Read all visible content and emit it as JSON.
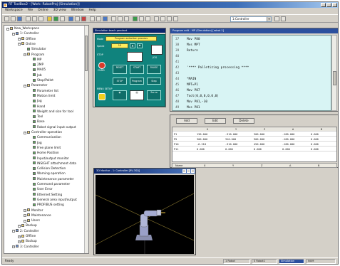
{
  "window": {
    "title": "RT ToolBox2 - [Work: RobotProj (Simulation)]"
  },
  "menu": [
    "Workspace",
    "File",
    "Online",
    "3D view",
    "Window",
    "Help"
  ],
  "toolbar": {
    "robot_combo": "1:Controller"
  },
  "tree": {
    "items": [
      {
        "label": "New_Workspace",
        "depth": 0,
        "icon": "yellow"
      },
      {
        "label": "1: Controller",
        "depth": 1,
        "icon": "blue"
      },
      {
        "label": "Offline",
        "depth": 2,
        "icon": "yellow"
      },
      {
        "label": "Online",
        "depth": 2,
        "icon": "yellow"
      },
      {
        "label": "Simulator",
        "depth": 3,
        "icon": "green"
      },
      {
        "label": "Program",
        "depth": 3,
        "icon": "yellow"
      },
      {
        "label": "MP",
        "depth": 4,
        "icon": "green"
      },
      {
        "label": "2MP",
        "depth": 4,
        "icon": "green"
      },
      {
        "label": "MA05",
        "depth": 4,
        "icon": "green"
      },
      {
        "label": "Job",
        "depth": 4,
        "icon": "green"
      },
      {
        "label": "Stop/Pallet",
        "depth": 4,
        "icon": "green"
      },
      {
        "label": "Parameter",
        "depth": 3,
        "icon": "yellow"
      },
      {
        "label": "Parameter list",
        "depth": 4,
        "icon": "green"
      },
      {
        "label": "Motion limit",
        "depth": 4,
        "icon": "green"
      },
      {
        "label": "Jog",
        "depth": 4,
        "icon": "green"
      },
      {
        "label": "Hand",
        "depth": 4,
        "icon": "green"
      },
      {
        "label": "Weight and size for tool",
        "depth": 4,
        "icon": "green"
      },
      {
        "label": "Tool",
        "depth": 4,
        "icon": "green"
      },
      {
        "label": "Base",
        "depth": 4,
        "icon": "green"
      },
      {
        "label": "Robot signal input output",
        "depth": 4,
        "icon": "green"
      },
      {
        "label": "Controller operation",
        "depth": 3,
        "icon": "yellow"
      },
      {
        "label": "Communication",
        "depth": 4,
        "icon": "green"
      },
      {
        "label": "Jog",
        "depth": 4,
        "icon": "green"
      },
      {
        "label": "Free plane limit",
        "depth": 4,
        "icon": "green"
      },
      {
        "label": "Home Position",
        "depth": 4,
        "icon": "green"
      },
      {
        "label": "Input/output monitor",
        "depth": 4,
        "icon": "green"
      },
      {
        "label": "INSIGHT attachment data",
        "depth": 4,
        "icon": "green"
      },
      {
        "label": "Collision Detection",
        "depth": 4,
        "icon": "green"
      },
      {
        "label": "Warning operation",
        "depth": 4,
        "icon": "green"
      },
      {
        "label": "Maintenance parameter",
        "depth": 4,
        "icon": "green"
      },
      {
        "label": "Command parameter",
        "depth": 4,
        "icon": "green"
      },
      {
        "label": "User Error",
        "depth": 4,
        "icon": "green"
      },
      {
        "label": "Ethernet Setting",
        "depth": 4,
        "icon": "green"
      },
      {
        "label": "General area input/output",
        "depth": 4,
        "icon": "green"
      },
      {
        "label": "PROFIBUS setting",
        "depth": 4,
        "icon": "green"
      },
      {
        "label": "Monitor",
        "depth": 3,
        "icon": "yellow"
      },
      {
        "label": "Maintenance",
        "depth": 3,
        "icon": "yellow"
      },
      {
        "label": "Users",
        "depth": 3,
        "icon": "yellow"
      },
      {
        "label": "Backup",
        "depth": 2,
        "icon": "yellow"
      },
      {
        "label": "2: Controller",
        "depth": 1,
        "icon": "blue"
      },
      {
        "label": "Offline",
        "depth": 2,
        "icon": "yellow"
      },
      {
        "label": "Backup",
        "depth": 2,
        "icon": "yellow"
      },
      {
        "label": "3: Controller",
        "depth": 1,
        "icon": "blue"
      }
    ]
  },
  "pendant": {
    "title": "Simulation teach pendant",
    "mode_label": "Mode",
    "mode_value": "Program selection process",
    "speed_label": "Speed",
    "speed_value": "10",
    "stop_label": "STOP",
    "jog_label": "JOG",
    "buttons": [
      "RESET",
      "START",
      "PAUSE",
      "STOP",
      "Program",
      "Step",
      "Servo",
      "Servo ON"
    ],
    "left_labels": [
      "OVRD",
      "MENU SETUP"
    ]
  },
  "editor": {
    "title": "Program edit - MP (Simulation) [robot 1]",
    "lines": [
      {
        "n": "37",
        "t": "Mov P80"
      },
      {
        "n": "38",
        "t": "Mvs MPT"
      },
      {
        "n": "39",
        "t": "Return"
      },
      {
        "n": "40",
        "t": ""
      },
      {
        "n": "41",
        "t": ""
      },
      {
        "n": "42",
        "t": "'**** Palletizing processing ****"
      },
      {
        "n": "43",
        "t": ""
      },
      {
        "n": "44",
        "t": "*MAIN"
      },
      {
        "n": "45",
        "t": "MPT=P1"
      },
      {
        "n": "46",
        "t": "Mov P87"
      },
      {
        "n": "47",
        "t": "Tool(0,0,0,0,0,0)"
      },
      {
        "n": "48",
        "t": "Mov P81,-30"
      },
      {
        "n": "49",
        "t": "Mvs P81"
      }
    ]
  },
  "vars": {
    "buttons": [
      "Add",
      "Edit",
      "Delete"
    ],
    "columns": [
      "",
      "X",
      "Y",
      "Z",
      "A",
      "B"
    ],
    "rows": [
      {
        "name": "P1",
        "cells": [
          "130.000",
          "-310.000",
          "300.000",
          "-180.000",
          "0.000"
        ]
      },
      {
        "name": "P5",
        "cells": [
          "300.000",
          "310.000",
          "900.000",
          "-180.000",
          "0.000"
        ]
      },
      {
        "name": "P10",
        "cells": "-",
        "cells_list": [
          "-6.218",
          "-310.000",
          "450.000",
          "-180.000",
          "0.000"
        ]
      },
      {
        "name": "P11",
        "cells_list": [
          "0.000",
          "0.000",
          "0.000",
          "0.000",
          "0.000"
        ]
      }
    ],
    "tabs": [
      "Name",
      "X",
      "Y",
      "Z",
      "A",
      "B"
    ]
  },
  "view3d": {
    "title": "3D Monitor - 1: Controller [RV-3SQ]"
  },
  "status": {
    "left": "Ready",
    "panels": [
      "1 Robot",
      "S Robot1",
      "Simulation",
      "NUM"
    ]
  }
}
